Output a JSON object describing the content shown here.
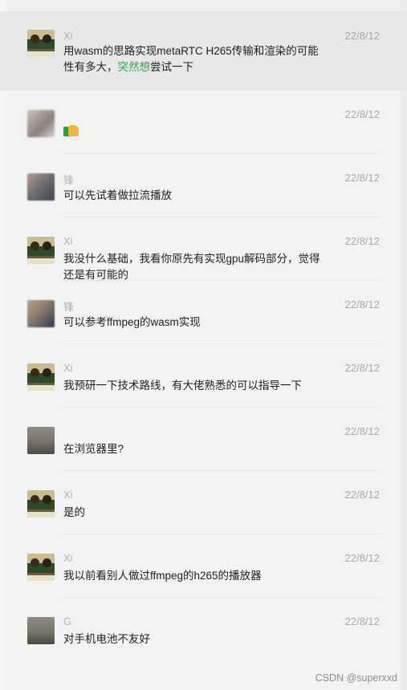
{
  "messages": [
    {
      "sender": "Xi",
      "time": "22/8/12",
      "text_parts": [
        "用wasm的思路实现metaRTC H265传输和渲染的可能性有多大，",
        "突然想",
        "尝试一下"
      ],
      "avatar": "xi",
      "highlight": true
    },
    {
      "sender": "",
      "time": "22/8/12",
      "sticker": "thumbs-up-sticker",
      "avatar": "blurred-1"
    },
    {
      "sender": "锋",
      "time": "22/8/12",
      "text": "可以先试着做拉流播放",
      "avatar": "blurred-2"
    },
    {
      "sender": "Xi",
      "time": "22/8/12",
      "text": "我没什么基础，我看你原先有实现gpu解码部分，觉得还是有可能的",
      "avatar": "xi"
    },
    {
      "sender": "锋",
      "time": "22/8/12",
      "text": "可以参考ffmpeg的wasm实现",
      "avatar": "blurred-3"
    },
    {
      "sender": "Xi",
      "time": "22/8/12",
      "text": "我预研一下技术路线，有大佬熟悉的可以指导一下",
      "avatar": "xi"
    },
    {
      "sender": "",
      "time": "22/8/12",
      "text": "在浏览器里?",
      "avatar": "landscape"
    },
    {
      "sender": "Xi",
      "time": "22/8/12",
      "text": "是的",
      "avatar": "xi"
    },
    {
      "sender": "Xi",
      "time": "22/8/12",
      "text": "我以前看别人做过ffmpeg的h265的播放器",
      "avatar": "xi"
    },
    {
      "sender": "G",
      "time": "22/8/12",
      "text": "对手机电池不友好",
      "avatar": "landscape"
    }
  ],
  "watermark": "CSDN @superxxd",
  "colors": {
    "highlight_bg": "#e8e8e8",
    "text_green": "#2ea44f",
    "sender_gray": "#b1b1b1"
  }
}
